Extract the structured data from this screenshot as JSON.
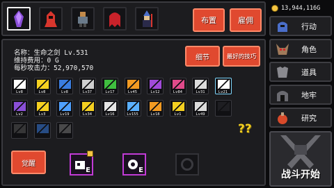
{
  "currency": {
    "amount": "13,944,116G",
    "coin_color": "#f5c542"
  },
  "heroes": [
    {
      "name": "purple-crystal-hero",
      "selected": true,
      "color": "#8a4fd8"
    },
    {
      "name": "red-hooded-hero",
      "selected": false,
      "color": "#d8362d"
    },
    {
      "name": "armored-warrior-hero",
      "selected": false,
      "color": "#c28a4a"
    },
    {
      "name": "red-ghost-hero",
      "selected": false,
      "color": "#c9222a"
    },
    {
      "name": "dark-mage-hero",
      "selected": false,
      "color": "#4a6ec9"
    }
  ],
  "top_buttons": {
    "deploy": "布置",
    "hire": "雇佣"
  },
  "hero_info": {
    "name_label": "名称：",
    "name_value": "生命之剑 Lv.531",
    "upkeep_label": "维持费用：",
    "upkeep_value": "0 G",
    "dps_label": "每秒攻击力：",
    "dps_value": "52,970,570"
  },
  "info_buttons": {
    "detail": "细节",
    "best_skills": "最好的技巧"
  },
  "skills_row1": [
    {
      "lv": "Lv8",
      "color": "#ffffff",
      "icon": "sword-icon"
    },
    {
      "lv": "Lv8",
      "color": "#f5d020",
      "icon": "armor-icon"
    },
    {
      "lv": "Lv8",
      "color": "#3a7de0",
      "icon": "blue-sword-icon"
    },
    {
      "lv": "Lv37",
      "color": "#cfcfcf",
      "icon": "hammer-icon"
    },
    {
      "lv": "Lv17",
      "color": "#3fbf3f",
      "icon": "green-blade-icon"
    },
    {
      "lv": "Lv45",
      "color": "#f29a22",
      "icon": "crossed-swords-icon"
    },
    {
      "lv": "Lv12",
      "color": "#a14ad9",
      "icon": "purple-blade-icon"
    },
    {
      "lv": "Lv84",
      "color": "#e04a8a",
      "icon": "pink-gem-icon"
    },
    {
      "lv": "Lv31",
      "color": "#dcdcdc",
      "icon": "shuriken-icon"
    },
    {
      "lv": "Lv21",
      "color": "#ffffff",
      "icon": "sparkle-icon",
      "highlight": true
    }
  ],
  "skills_row2": [
    {
      "lv": "Lv2",
      "color": "#8a4fd8",
      "icon": "dagger-icon"
    },
    {
      "lv": "Lv3",
      "color": "#f5d020",
      "icon": "gold-trophy-icon"
    },
    {
      "lv": "Lv19",
      "color": "#4fa0ff",
      "icon": "blue-flame-icon"
    },
    {
      "lv": "Lv34",
      "color": "#f5d020",
      "icon": "gold-shield-icon"
    },
    {
      "lv": "Lv16",
      "color": "#e6e6e6",
      "icon": "white-blade-icon"
    },
    {
      "lv": "Lv155",
      "color": "#5ab0ff",
      "icon": "blue-burst-icon"
    },
    {
      "lv": "Lv18",
      "color": "#f29a22",
      "icon": "orange-burst-icon"
    },
    {
      "lv": "Lv1",
      "color": "#f5d020",
      "icon": "yellow-arrow-icon"
    },
    {
      "lv": "Lv49",
      "color": "#dcdcdc",
      "icon": "crescent-icon"
    },
    {
      "lv": "",
      "color": "#2a2a2e",
      "icon": "empty-shield-icon"
    }
  ],
  "skills_row3": [
    {
      "lv": "",
      "color": "#555",
      "icon": "slash-icon"
    },
    {
      "lv": "",
      "color": "#3a7de0",
      "icon": "z-rune-icon"
    },
    {
      "lv": "",
      "color": "#777",
      "icon": "music-note-icon"
    }
  ],
  "question_marks": "??",
  "awaken_button": "觉醒",
  "equip_slots": [
    {
      "label": "E",
      "locked": true,
      "color": "#c23bd6"
    },
    {
      "label": "E",
      "locked": false,
      "color": "#c23bd6"
    }
  ],
  "nav": [
    {
      "label": "行动",
      "icon": "knight-helmet-icon"
    },
    {
      "label": "角色",
      "icon": "demon-skull-icon"
    },
    {
      "label": "道具",
      "icon": "armor-chest-icon"
    },
    {
      "label": "地牢",
      "icon": "dungeon-gate-icon"
    },
    {
      "label": "研究",
      "icon": "potion-icon"
    }
  ],
  "battle_start": "战斗开始"
}
